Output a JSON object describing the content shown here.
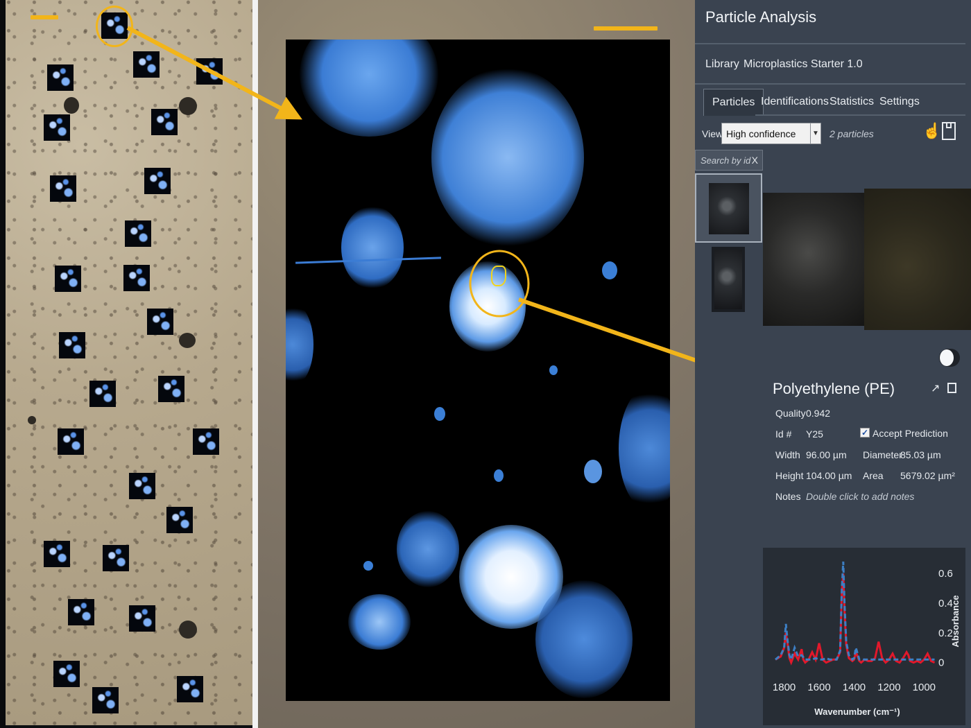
{
  "panel": {
    "title": "Particle Analysis",
    "library_label": "Library",
    "library_value": "Microplastics Starter 1.0",
    "tabs": [
      {
        "label": "Particles",
        "active": true
      },
      {
        "label": "Identifications",
        "active": false
      },
      {
        "label": "Statistics",
        "active": false
      },
      {
        "label": "Settings",
        "active": false
      }
    ],
    "view_label": "View",
    "view_value": "High confidence",
    "particle_count": "2 particles",
    "search_placeholder": "Search by id",
    "search_clear": "X"
  },
  "particle": {
    "name": "Polyethylene (PE)",
    "quality_label": "Quality",
    "quality": "0.942",
    "id_label": "Id #",
    "id": "Y25",
    "accept_label": "Accept Prediction",
    "accepted": true,
    "width_label": "Width",
    "width": "96.00 µm",
    "diameter_label": "Diameter",
    "diameter": "85.03 µm",
    "height_label": "Height",
    "height": "104.00 µm",
    "area_label": "Area",
    "area": "5679.02 µm²",
    "notes_label": "Notes",
    "notes_placeholder": "Double click to add notes"
  },
  "icons": [
    "hand-pointer-icon",
    "save-icon",
    "external-link-icon",
    "export-icon",
    "close-icon",
    "checkbox-icon"
  ],
  "colors": {
    "accent_yellow": "#f2b51a",
    "panel_bg": "#3a4350",
    "sample_spectrum": "#e2182b",
    "library_spectrum": "#3d7fc4"
  },
  "chart_data": {
    "type": "line",
    "xlabel": "Wavenumber (cm⁻¹)",
    "ylabel": "Absorbance",
    "x_ticks": [
      1800,
      1600,
      1400,
      1200,
      1000
    ],
    "y_ticks": [
      0,
      0.2,
      0.4,
      0.6
    ],
    "xlim": [
      1850,
      930
    ],
    "ylim": [
      -0.03,
      0.68
    ],
    "x_reversed": true,
    "series": [
      {
        "color": "#e2182b",
        "x": [
          1850,
          1820,
          1800,
          1790,
          1780,
          1770,
          1760,
          1740,
          1720,
          1700,
          1690,
          1680,
          1660,
          1640,
          1620,
          1600,
          1580,
          1560,
          1540,
          1520,
          1500,
          1480,
          1470,
          1462,
          1455,
          1445,
          1430,
          1410,
          1400,
          1390,
          1370,
          1360,
          1340,
          1320,
          1300,
          1280,
          1260,
          1240,
          1220,
          1200,
          1180,
          1160,
          1140,
          1120,
          1100,
          1090,
          1080,
          1060,
          1040,
          1020,
          1000,
          980,
          960,
          940
        ],
        "y": [
          0.02,
          0.04,
          0.1,
          0.2,
          0.12,
          0.03,
          0.0,
          0.06,
          0.02,
          0.09,
          0.02,
          0.0,
          0.02,
          0.07,
          0.02,
          0.13,
          0.02,
          0.0,
          0.01,
          0.02,
          0.02,
          0.07,
          0.48,
          0.6,
          0.35,
          0.12,
          0.03,
          0.01,
          0.02,
          0.07,
          0.01,
          0.0,
          0.02,
          0.01,
          0.01,
          0.03,
          0.14,
          0.03,
          0.0,
          0.02,
          0.06,
          0.01,
          0.0,
          0.03,
          0.07,
          0.05,
          0.01,
          0.0,
          0.01,
          0.0,
          0.02,
          0.06,
          0.01,
          0.0
        ]
      },
      {
        "color": "#3d7fc4",
        "x": [
          1850,
          1820,
          1800,
          1790,
          1780,
          1770,
          1760,
          1740,
          1720,
          1700,
          1680,
          1660,
          1640,
          1620,
          1600,
          1580,
          1560,
          1540,
          1520,
          1500,
          1480,
          1470,
          1462,
          1455,
          1445,
          1430,
          1410,
          1400,
          1390,
          1370,
          1360,
          1340,
          1320,
          1300,
          1280,
          1260,
          1240,
          1220,
          1200,
          1180,
          1160,
          1140,
          1120,
          1100,
          1080,
          1060,
          1040,
          1020,
          1000,
          980,
          960,
          940
        ],
        "y": [
          0.02,
          0.05,
          0.1,
          0.26,
          0.14,
          0.05,
          0.02,
          0.1,
          0.04,
          0.05,
          0.02,
          0.02,
          0.02,
          0.03,
          0.02,
          0.02,
          0.03,
          0.02,
          0.02,
          0.02,
          0.08,
          0.5,
          0.68,
          0.4,
          0.14,
          0.05,
          0.02,
          0.03,
          0.1,
          0.02,
          0.02,
          0.02,
          0.02,
          0.02,
          0.02,
          0.02,
          0.02,
          0.02,
          0.02,
          0.02,
          0.02,
          0.02,
          0.02,
          0.02,
          0.02,
          0.02,
          0.02,
          0.02,
          0.02,
          0.02,
          0.02,
          0.02
        ]
      }
    ]
  }
}
